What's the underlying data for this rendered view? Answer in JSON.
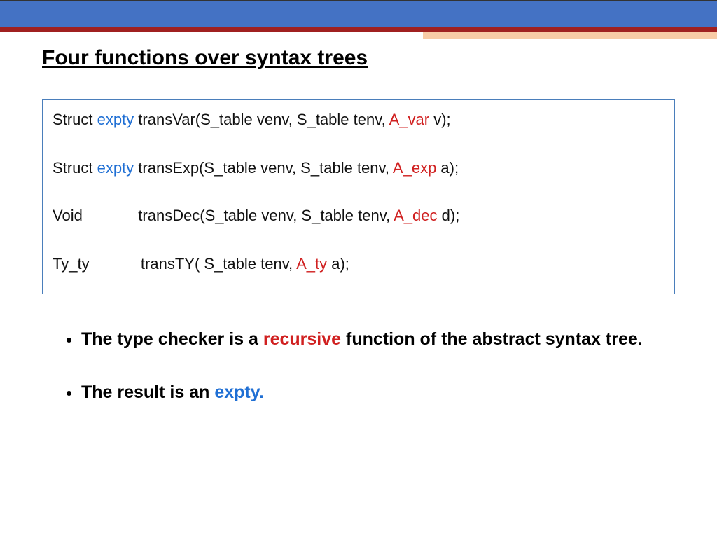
{
  "title": "Four functions over syntax trees",
  "code": {
    "row1": {
      "a": "Struct ",
      "b": "expty",
      "c": " transVar(S_table venv, S_table tenv, ",
      "d": "A_var",
      "e": "  v);"
    },
    "row2": {
      "a": "Struct ",
      "b": "expty",
      "c": " transExp(S_table venv, S_table tenv, ",
      "d": "A_exp",
      "e": " a);"
    },
    "row3": {
      "a": "Void             transDec(S_table venv, S_table tenv, ",
      "d": "A_dec",
      "e": " d);"
    },
    "row4": {
      "a": "Ty_ty            transTY( S_table tenv, ",
      "d": "A_ty",
      "e": " a);"
    }
  },
  "bullets": {
    "b1": {
      "a": "The type checker is a ",
      "b": "recursive",
      "c": " function of the abstract syntax tree."
    },
    "b2": {
      "a": "The result is an ",
      "b": "expty."
    }
  }
}
